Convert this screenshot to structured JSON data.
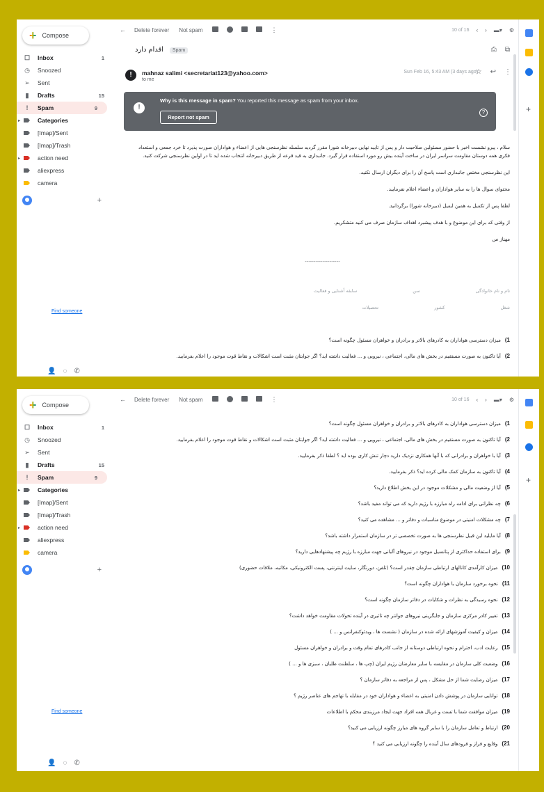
{
  "compose_label": "Compose",
  "nav": [
    {
      "label": "Inbox",
      "icon": "inbox-icon",
      "glyph": "☐",
      "bold": true,
      "count": "1"
    },
    {
      "label": "Snoozed",
      "icon": "clock-icon",
      "glyph": "◷",
      "bold": false,
      "count": ""
    },
    {
      "label": "Sent",
      "icon": "send-icon",
      "glyph": "➢",
      "bold": false,
      "count": ""
    },
    {
      "label": "Drafts",
      "icon": "draft-icon",
      "glyph": "▮",
      "bold": true,
      "count": "15"
    },
    {
      "label": "Spam",
      "icon": "spam-icon",
      "glyph": "!",
      "bold": true,
      "count": "9",
      "active": true
    },
    {
      "label": "Categories",
      "icon": "label-icon",
      "tag": true,
      "bold": true,
      "count": "",
      "arrow": true
    },
    {
      "label": "[Imap]/Sent",
      "icon": "label-icon",
      "tag": true,
      "bold": false,
      "count": ""
    },
    {
      "label": "[Imap]/Trash",
      "icon": "label-icon",
      "tag": true,
      "bold": false,
      "count": ""
    },
    {
      "label": "action need",
      "icon": "label-icon",
      "tag": true,
      "tagColor": "#d93025",
      "bold": false,
      "count": "",
      "arrow": true
    },
    {
      "label": "aliexpress",
      "icon": "label-icon",
      "tag": true,
      "bold": false,
      "count": ""
    },
    {
      "label": "camera",
      "icon": "label-icon",
      "tag": true,
      "tagColor": "#fbbc04",
      "bold": false,
      "count": ""
    }
  ],
  "find_someone": "Find someone",
  "toolbar": {
    "delete_forever": "Delete forever",
    "not_spam": "Not spam",
    "pager1": "10 of 16",
    "pager2": "10 of 16"
  },
  "email": {
    "subject": "اقدام دارد",
    "sender": "mahnaz salimi <secretariat123@yahoo.com>",
    "to": "to me",
    "date": "Sun Feb 16, 5:43 AM (3 days ago)"
  },
  "spam_banner": {
    "title": "Why is this message in spam?",
    "text": " You reported this message as spam from your inbox.",
    "button": "Report not spam"
  },
  "body_paragraphs": [
    "سلام ، پیرو نشست اخیر با حضور مسئولین صلاحیت دار و پس از تایید نهایی دبیرخانه شورا مقرر گردید سلسله نظرسنجی هایی از اعضاء و هواداران صورت پذیرد تا خرد جمعی و استعداد فکری همه دوستان مقاومت سراسر ایران در ساخت آینده بیش رو مورد استفاده قرار گیرد. جانبداری به قید قرعه از طریق دبیرخانه انتخاب شده اید تا در اولین نظرسنجی شرکت کنید.",
    "این نظرسنجی مختص جانبداری است پاسخ آن را برای دیگران ارسال نکنید.",
    "محتوای سوال ها را به سایر هواداران و اعضاء اعلام نفرمایید.",
    "لطفا پس از تکمیل به همین ایمیل (دبیرخانه شورا) برگردانید.",
    "از وقتی که برای این موضوع و با هدف پیشبرد اهداف سازمان صرف می کنید متشکریم.",
    "مهناز س"
  ],
  "signature_line": "--------------------",
  "sig_rows": [
    [
      "نام و نام خانوادگی",
      "سن",
      "سابقه آشنایی و فعالیت"
    ],
    [
      "شغل",
      "کشور",
      "تحصیلات"
    ]
  ],
  "questions": [
    {
      "n": "1)",
      "text": "میزان دسترسی هواداران به کادرهای بالاتر و برادران و خواهران مسئول چگونه است؟"
    },
    {
      "n": "2)",
      "text": "آیا تاکنون به صورت مستقیم در بخش های مالی، اجتماعی ، نیرویی و ... فعالیت داشته اید؟ اگر جوابتان مثبت است اشکالات و نقاط قوت موجود را اعلام بفرمایید."
    },
    {
      "n": "3)",
      "text": "آیا با خواهران و برادرانی که با آنها همکاری نزدیک دارید دچار تنش کاری بوده اید ؟ لطفا ذکر بفرمایید."
    },
    {
      "n": "4)",
      "text": "آیا تاکنون به سازمان کمک مالی کرده اید؟ ذکر بفرمایید."
    },
    {
      "n": "5)",
      "text": "آیا از وضعیت مالی و مشکلات موجود در این بخش اطلاع دارید؟"
    },
    {
      "n": "6)",
      "text": "چه نظراتی برای ادامه راه مبارزه با رژیم دارید که می تواند مفید باشد؟"
    },
    {
      "n": "7)",
      "text": "چه مشکلات امنیتی در موضوع مناسبات و دفاتر و ... مشاهده می کنید؟"
    },
    {
      "n": "8)",
      "text": "آیا مایلید این قبیل نظرسنجی ها به صورت تخصصی تر در سازمان استمرار داشته باشد؟"
    },
    {
      "n": "9)",
      "text": "برای استفاده حداکثری از پتانسیل موجود در نیروهای آلبانی جهت مبارزه با رژیم چه پیشنهادهایی دارید؟"
    },
    {
      "n": "10)",
      "text": "میزان کارآمدی کانالهای ارتباطی سازمان چقدر است؟ (تلفن، دورنگار، سایت اینترنتی، پست الکترونیکی، مکاتبه، ملاقات حضوری)"
    },
    {
      "n": "11)",
      "text": "نحوه برخورد سازمان با هواداران چگونه است؟"
    },
    {
      "n": "12)",
      "text": "نحوه رسیدگی به نظرات و شکایات در دفاتر سازمان چگونه است؟"
    },
    {
      "n": "13)",
      "text": "تغییر کادر مرکزی سازمان و جایگزینی نیروهای جوانتر چه تاثیری در آینده تحولات مقاومت خواهد داشت؟"
    },
    {
      "n": "14)",
      "text": "میزان و کیفیت آموزشهای ارائه شده در سازمان ( نشست ها ، ویدئوکنفرانس و ... )"
    },
    {
      "n": "15)",
      "text": "رعایت ادب، احترام و نحوه ارتباطی دوستانه از جانب کادرهای تمام وقت و برادران و خواهران مسئول"
    },
    {
      "n": "16)",
      "text": "وضعیت کلی سازمان در مقایسه با سایر معارضان رژیم ایران (چپ ها ، سلطنت طلبان ، سبزی ها و ... )"
    },
    {
      "n": "17)",
      "text": "میزان رضایت شما از حل مشکل ، پس از مراجعه به دفاتر سازمان ؟"
    },
    {
      "n": "18)",
      "text": "توانایی سازمان در پوشش دادن امنیتی به اعضاء و هواداران خود در مقابله با تهاجم های عناصر رژیم ؟"
    },
    {
      "n": "19)",
      "text": "میزان موافقت شما با تست و غربال همه افراد جهت ایجاد مرزبندی محکم با اطلاعات"
    },
    {
      "n": "20)",
      "text": "ارتباط و تعامل سازمان را با سایر گروه های مبارز چگونه ارزیابی می کنید؟"
    },
    {
      "n": "21)",
      "text": "وقایع و فراز و فرودهای سال آینده را چگونه ارزیابی می کنید ؟"
    }
  ],
  "colors": {
    "frame": "#c2b000",
    "spam_banner": "#5f6368",
    "accent": "#1a73e8"
  }
}
